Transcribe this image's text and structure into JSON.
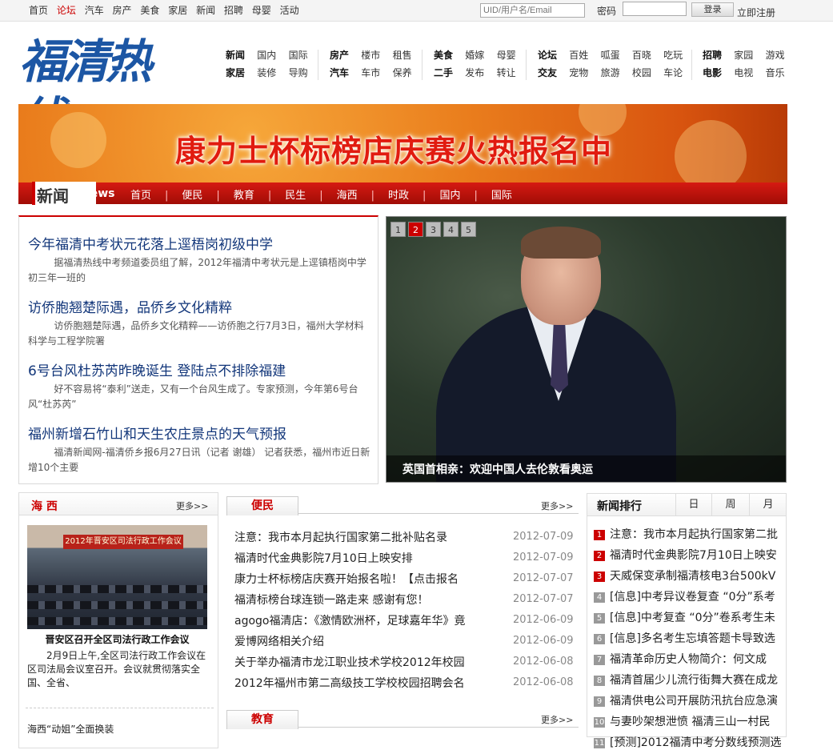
{
  "topbar": {
    "nav": [
      {
        "label": "首页",
        "hot": false
      },
      {
        "label": "论坛",
        "hot": true
      },
      {
        "label": "汽车",
        "hot": false
      },
      {
        "label": "房产",
        "hot": false
      },
      {
        "label": "美食",
        "hot": false
      },
      {
        "label": "家居",
        "hot": false
      },
      {
        "label": "新闻",
        "hot": false
      },
      {
        "label": "招聘",
        "hot": false
      },
      {
        "label": "母婴",
        "hot": false
      },
      {
        "label": "活动",
        "hot": false
      }
    ],
    "uid_placeholder": "UID/用户名/Email",
    "password_label": "密码",
    "login_button": "登录",
    "register_link": "立即注册"
  },
  "logo": {
    "text": "福清热线",
    "color": "#1c56a4"
  },
  "mainnav": {
    "row1": [
      [
        "新闻",
        "国内",
        "国际"
      ],
      [
        "房产",
        "楼市",
        "租售"
      ],
      [
        "美食",
        "婚嫁",
        "母婴"
      ],
      [
        "论坛",
        "百姓",
        "呱蛋",
        "百晓",
        "吃玩"
      ],
      [
        "招聘",
        "家园",
        "游戏"
      ]
    ],
    "row2": [
      [
        "家居",
        "装修",
        "导购"
      ],
      [
        "汽车",
        "车市",
        "保养"
      ],
      [
        "二手",
        "发布",
        "转让"
      ],
      [
        "交友",
        "宠物",
        "旅游",
        "校园",
        "车论"
      ],
      [
        "电影",
        "电视",
        "音乐"
      ]
    ]
  },
  "banner": {
    "text": "康力士杯标榜店庆赛火热报名中"
  },
  "newsbar": {
    "label_cn": "新闻",
    "label_en": "News",
    "items": [
      "首页",
      "便民",
      "教育",
      "民生",
      "海西",
      "时政",
      "国内",
      "国际"
    ],
    "separator": "|"
  },
  "headlines": [
    {
      "title": "今年福清中考状元花落上逕梧岗初级中学",
      "summary": "据福清热线中考频道委员组了解，2012年福清中考状元是上逕镇梧岗中学初三年一班的"
    },
    {
      "title": "访侨胞翘楚际遇，品侨乡文化精粹",
      "summary": "访侨胞翘楚际遇，品侨乡文化精粹——访侨胞之行7月3日，福州大学材料科学与工程学院署"
    },
    {
      "title": "6号台风杜苏芮昨晚诞生  登陆点不排除福建",
      "summary": "好不容易将“泰利”送走，又有一个台风生成了。专家预测，今年第6号台风“杜苏芮”"
    },
    {
      "title": "福州新增石竹山和天生农庄景点的天气预报",
      "summary": "福清新闻网-福清侨乡报6月27日讯（记者 谢雄） 记者获悉，福州市近日新增10个主要"
    }
  ],
  "slideshow": {
    "pages": [
      "1",
      "2",
      "3",
      "4",
      "5"
    ],
    "active": 2,
    "caption": "英国首相亲：欢迎中国人去伦敦看奥运"
  },
  "haixi": {
    "title": "海 西",
    "more": "更多>>",
    "image_banner": "2012年晋安区司法行政工作会议",
    "image_caption": "晋安区召开全区司法行政工作会议",
    "text": "2月9日上午,全区司法行政工作会议在区司法局会议室召开。会议就贯彻落实全国、全省、",
    "item": "海西“动姐”全面换装"
  },
  "bianmin": {
    "tab": "便民",
    "more": "更多>>",
    "items": [
      {
        "title": "注意：我市本月起执行国家第二批补贴名录",
        "date": "2012-07-09"
      },
      {
        "title": "福清时代金典影院7月10日上映安排",
        "date": "2012-07-09"
      },
      {
        "title": "康力士杯标榜店庆赛开始报名啦！【点击报名",
        "date": "2012-07-07"
      },
      {
        "title": "福清标榜台球连锁一路走来 感谢有您！",
        "date": "2012-07-07"
      },
      {
        "title": "agogo福清店：《激情欧洲杯，足球嘉年华》竟",
        "date": "2012-06-09"
      },
      {
        "title": "爱博网络相关介绍",
        "date": "2012-06-09"
      },
      {
        "title": "关于举办福清市龙江职业技术学校2012年校园",
        "date": "2012-06-08"
      },
      {
        "title": "2012年福州市第二高级技工学校校园招聘会名",
        "date": "2012-06-08"
      }
    ]
  },
  "jiaoyu": {
    "tab": "教育",
    "more": "更多>>"
  },
  "ranking": {
    "title": "新闻排行",
    "tabs": [
      "日",
      "周",
      "月"
    ],
    "items": [
      {
        "n": "1",
        "text": "注意：我市本月起执行国家第二批"
      },
      {
        "n": "2",
        "text": "福清时代金典影院7月10日上映安"
      },
      {
        "n": "3",
        "text": "天威保变承制福清核电3台500kV"
      },
      {
        "n": "4",
        "text": "[信息]中考异议卷复查 “0分”系考"
      },
      {
        "n": "5",
        "text": "[信息]中考复查 “0分”卷系考生未"
      },
      {
        "n": "6",
        "text": "[信息]多名考生忘填答题卡导致选"
      },
      {
        "n": "7",
        "text": "福清革命历史人物简介：何文成"
      },
      {
        "n": "8",
        "text": "福清首届少儿流行街舞大赛在成龙"
      },
      {
        "n": "9",
        "text": "福清供电公司开展防汛抗台应急演"
      },
      {
        "n": "10",
        "text": "与妻吵架想泄愤 福清三山一村民"
      },
      {
        "n": "11",
        "text": "[预测]2012福清中考分数线预测选"
      }
    ]
  }
}
